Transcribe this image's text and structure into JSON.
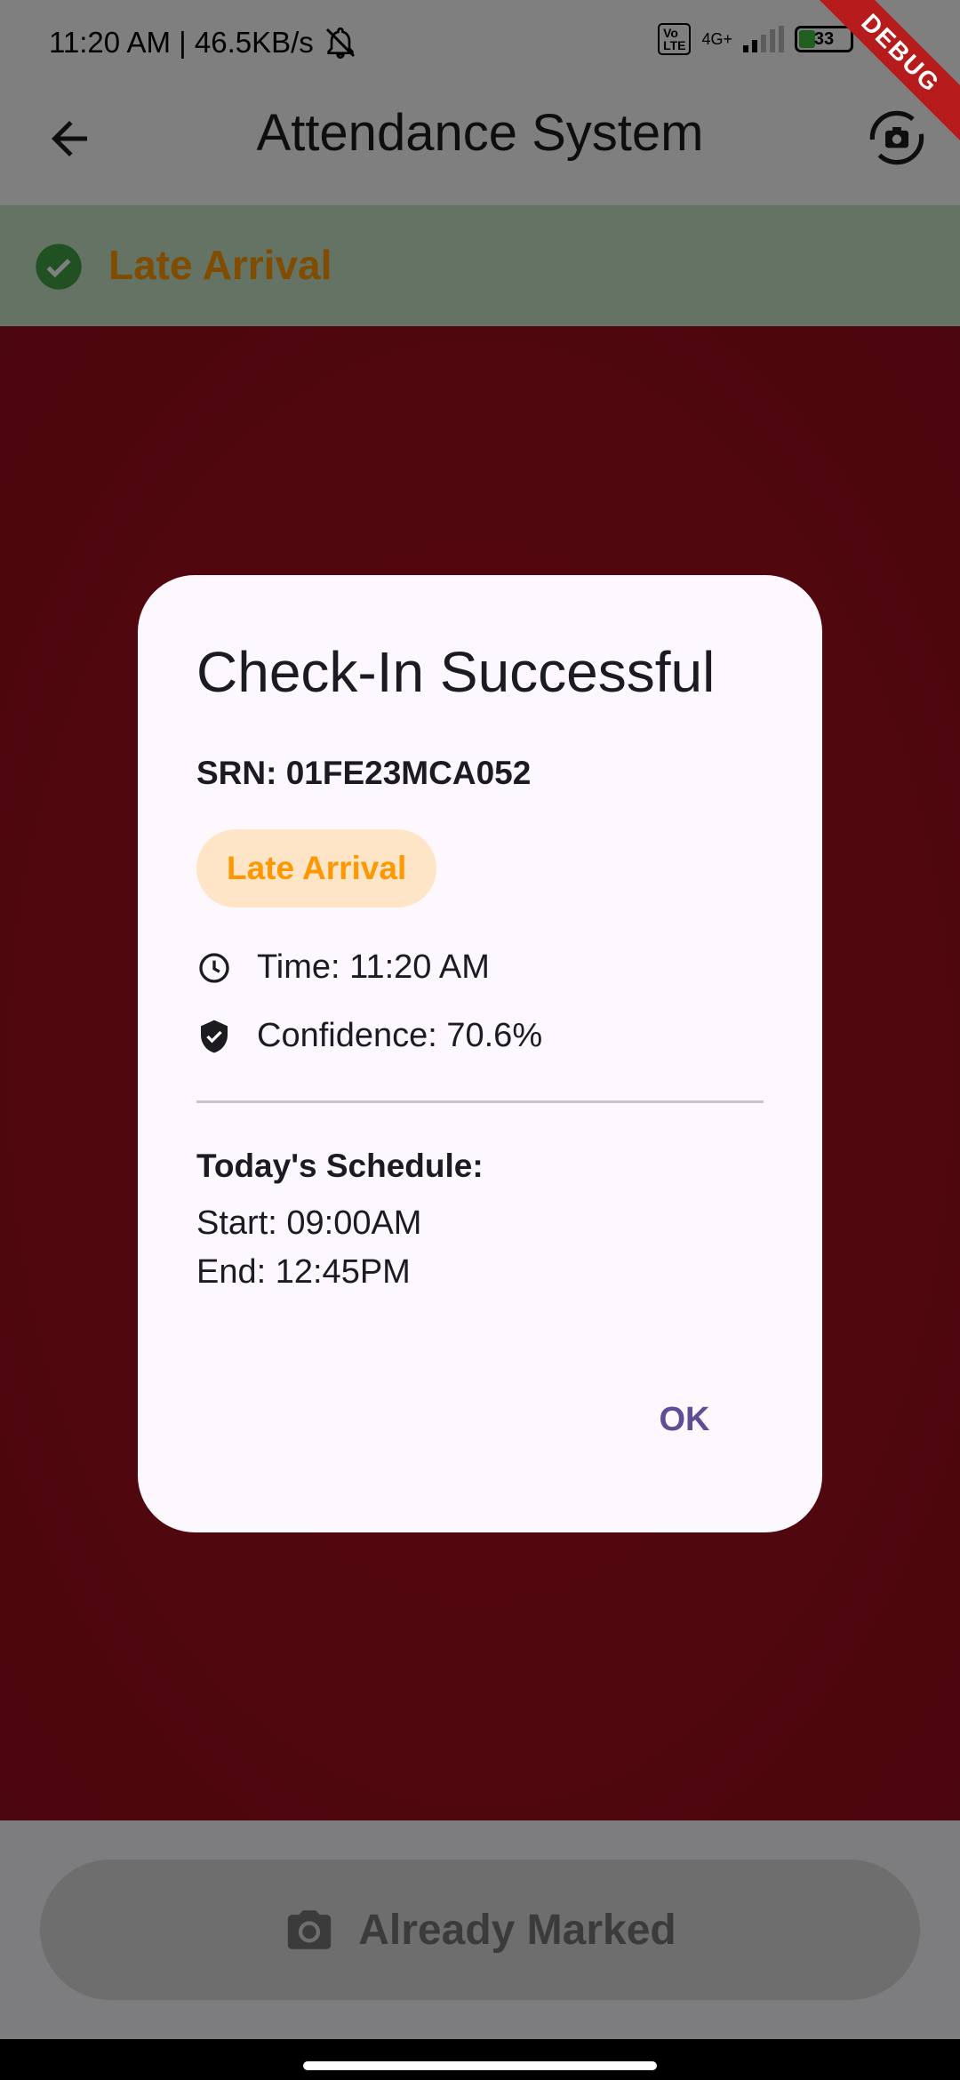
{
  "status_bar": {
    "time_speed": "11:20 AM | 46.5KB/s",
    "network_label": "4G+",
    "volte": "Vo\nLTE",
    "battery": "33",
    "debug_label": "DEBUG"
  },
  "app_bar": {
    "title": "Attendance System",
    "back_icon": "arrow-back-icon",
    "switch_camera_icon": "switch-camera-icon"
  },
  "status_banner": {
    "label": "Late Arrival",
    "color": "#ff9800"
  },
  "bottom": {
    "button_label": "Already Marked",
    "button_icon": "camera-icon"
  },
  "dialog": {
    "title": "Check-In Successful",
    "srn": "SRN: 01FE23MCA052",
    "chip_label": "Late Arrival",
    "time_text": "Time: 11:20 AM",
    "confidence_text": "Confidence: 70.6%",
    "schedule_heading": "Today's Schedule:",
    "schedule_start": "Start: 09:00AM",
    "schedule_end": "End: 12:45PM",
    "ok_label": "OK",
    "accent_color": "#5e4e93"
  }
}
